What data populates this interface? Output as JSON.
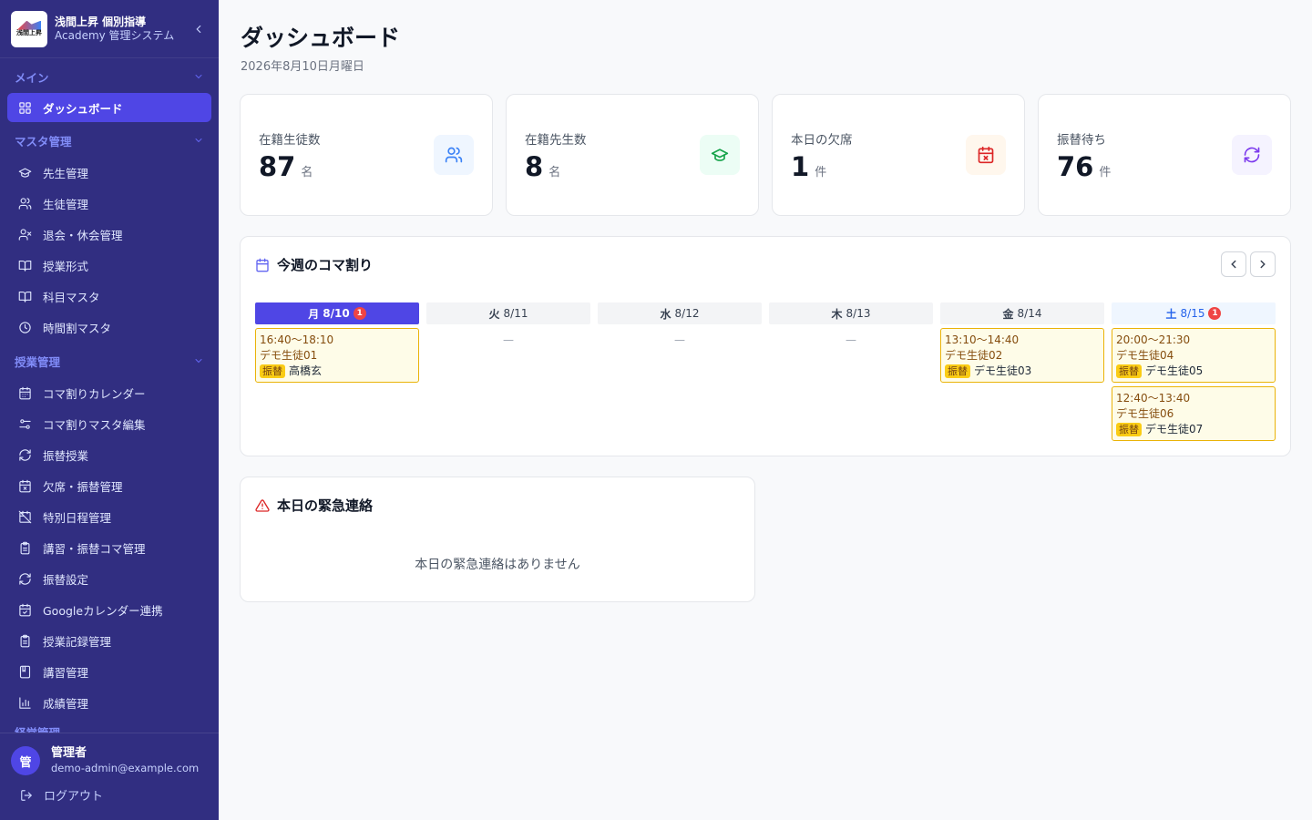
{
  "brand": {
    "name": "浅間上昇 個別指導",
    "sub": "Academy 管理システム",
    "logo_text": "浅間上昇"
  },
  "sidebar": {
    "sections": [
      {
        "title": "メイン",
        "items": [
          {
            "label": "ダッシュボード",
            "icon": "grid-icon",
            "active": true
          }
        ]
      },
      {
        "title": "マスタ管理",
        "items": [
          {
            "label": "先生管理",
            "icon": "graduation-cap-icon"
          },
          {
            "label": "生徒管理",
            "icon": "users-icon"
          },
          {
            "label": "退会・休会管理",
            "icon": "user-x-icon"
          },
          {
            "label": "授業形式",
            "icon": "book-open-icon"
          },
          {
            "label": "科目マスタ",
            "icon": "book-open-icon"
          },
          {
            "label": "時間割マスタ",
            "icon": "clock-icon"
          }
        ]
      },
      {
        "title": "授業管理",
        "items": [
          {
            "label": "コマ割りカレンダー",
            "icon": "calendar-icon"
          },
          {
            "label": "コマ割りマスタ編集",
            "icon": "sliders-icon"
          },
          {
            "label": "振替授業",
            "icon": "refresh-icon"
          },
          {
            "label": "欠席・振替管理",
            "icon": "calendar-x-icon"
          },
          {
            "label": "特別日程管理",
            "icon": "calendar-off-icon"
          },
          {
            "label": "講習・振替コマ管理",
            "icon": "clipboard-icon"
          },
          {
            "label": "振替設定",
            "icon": "refresh-icon"
          },
          {
            "label": "Googleカレンダー連携",
            "icon": "calendar-check-icon"
          },
          {
            "label": "授業記録管理",
            "icon": "clipboard-icon"
          },
          {
            "label": "講習管理",
            "icon": "notebook-icon"
          },
          {
            "label": "成績管理",
            "icon": "bar-chart-icon"
          }
        ]
      }
    ],
    "cut_section": "経営管理"
  },
  "user": {
    "initial": "管",
    "name": "管理者",
    "email": "demo-admin@example.com",
    "logout_label": "ログアウト"
  },
  "page": {
    "title": "ダッシュボード",
    "date": "2026年8月10日月曜日"
  },
  "stats": [
    {
      "label": "在籍生徒数",
      "value": "87",
      "unit": "名",
      "icon": "users-icon",
      "bg": "#eff6ff",
      "color": "#3b82f6"
    },
    {
      "label": "在籍先生数",
      "value": "8",
      "unit": "名",
      "icon": "graduation-cap-icon",
      "bg": "#ecfdf5",
      "color": "#16a34a"
    },
    {
      "label": "本日の欠席",
      "value": "1",
      "unit": "件",
      "icon": "calendar-x-icon",
      "bg": "#fff7ed",
      "color": "#dc2626"
    },
    {
      "label": "振替待ち",
      "value": "76",
      "unit": "件",
      "icon": "refresh-icon",
      "bg": "#f5f3ff",
      "color": "#7c3aed"
    }
  ],
  "week": {
    "title": "今週のコマ割り",
    "days": [
      {
        "dow": "月",
        "date": "8/10",
        "badge": "1",
        "style": "today",
        "slots": [
          {
            "time": "16:40〜18:10",
            "student": "デモ生徒01",
            "tag": "振替",
            "teacher": "高橋玄"
          }
        ]
      },
      {
        "dow": "火",
        "date": "8/11",
        "style": "",
        "empty": "—",
        "slots": []
      },
      {
        "dow": "水",
        "date": "8/12",
        "style": "",
        "empty": "—",
        "slots": []
      },
      {
        "dow": "木",
        "date": "8/13",
        "style": "",
        "empty": "—",
        "slots": []
      },
      {
        "dow": "金",
        "date": "8/14",
        "style": "",
        "slots": [
          {
            "time": "13:10〜14:40",
            "student": "デモ生徒02",
            "tag": "振替",
            "teacher": "デモ生徒03"
          }
        ]
      },
      {
        "dow": "土",
        "date": "8/15",
        "badge": "1",
        "style": "sat",
        "slots": [
          {
            "time": "20:00〜21:30",
            "student": "デモ生徒04",
            "tag": "振替",
            "teacher": "デモ生徒05"
          },
          {
            "time": "12:40〜13:40",
            "student": "デモ生徒06",
            "tag": "振替",
            "teacher": "デモ生徒07"
          }
        ]
      }
    ]
  },
  "urgent": {
    "title": "本日の緊急連絡",
    "empty": "本日の緊急連絡はありません"
  }
}
